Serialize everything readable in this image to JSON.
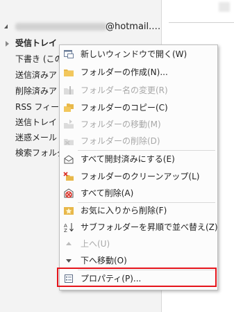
{
  "account": {
    "domain": "@hotmail.…"
  },
  "folders": [
    {
      "label": "受信トレイ",
      "bold": true
    },
    {
      "label": "下書き (この"
    },
    {
      "label": "送信済みア"
    },
    {
      "label": "削除済みア"
    },
    {
      "label": "RSS フィード"
    },
    {
      "label": "送信トレイ"
    },
    {
      "label": "迷惑メール"
    },
    {
      "label": "検索フォルダ"
    }
  ],
  "context_menu": {
    "items": [
      {
        "label": "新しいウィンドウで開く(W)",
        "icon": "new-window-icon",
        "enabled": true
      },
      {
        "label": "フォルダーの作成(N)...",
        "icon": "new-folder-icon",
        "enabled": true
      },
      {
        "label": "フォルダー名の変更(R)",
        "icon": "rename-folder-icon",
        "enabled": false
      },
      {
        "label": "フォルダーのコピー(C)",
        "icon": "copy-folder-icon",
        "enabled": true
      },
      {
        "label": "フォルダーの移動(M)",
        "icon": "move-folder-icon",
        "enabled": false
      },
      {
        "label": "フォルダーの削除(D)",
        "icon": "delete-folder-icon",
        "enabled": false
      },
      {
        "label": "すべて開封済みにする(E)",
        "icon": "mark-all-read-icon",
        "enabled": true
      },
      {
        "label": "フォルダーのクリーンアップ(L)",
        "icon": "cleanup-folder-icon",
        "enabled": true
      },
      {
        "label": "すべて削除(A)",
        "icon": "delete-all-icon",
        "enabled": true
      },
      {
        "label": "お気に入りから削除(F)",
        "icon": "favorite-remove-icon",
        "enabled": true
      },
      {
        "label": "サブフォルダーを昇順で並べ替え(Z)",
        "icon": "sort-az-icon",
        "enabled": true
      },
      {
        "label": "上へ(U)",
        "icon": "move-up-icon",
        "enabled": false
      },
      {
        "label": "下へ移動(O)",
        "icon": "move-down-icon",
        "enabled": true
      },
      {
        "label": "プロパティ(P)...",
        "icon": "properties-icon",
        "enabled": true
      }
    ]
  },
  "colors": {
    "highlight": "#e5141b",
    "folder_yellow": "#e8b84a"
  }
}
